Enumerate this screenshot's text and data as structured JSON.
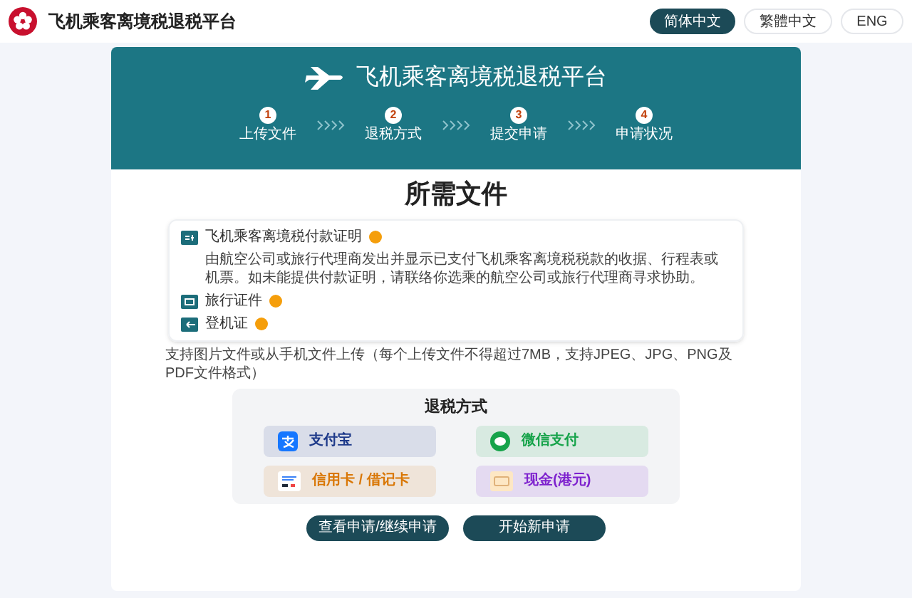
{
  "header": {
    "title": "飞机乘客离境税退税平台",
    "languages": [
      {
        "label": "简体中文",
        "selected": true
      },
      {
        "label": "繁體中文",
        "selected": false
      },
      {
        "label": "ENG",
        "selected": false
      }
    ]
  },
  "banner": {
    "title": "飞机乘客离境税退税平台",
    "steps": [
      {
        "number": "1",
        "label": "上传文件"
      },
      {
        "number": "2",
        "label": "退税方式"
      },
      {
        "number": "3",
        "label": "提交申请"
      },
      {
        "number": "4",
        "label": "申请状况"
      }
    ]
  },
  "documents": {
    "title": "所需文件",
    "items": [
      {
        "kind": "receipt",
        "label": "飞机乘客离境税付款证明",
        "description": "由航空公司或旅行代理商发出并显示已支付飞机乘客离境税税款的收据、行程表或机票。如未能提供付款证明，请联络你选乘的航空公司或旅行代理商寻求协助。"
      },
      {
        "kind": "passport",
        "label": "旅行证件"
      },
      {
        "kind": "boarding",
        "label": "登机证"
      }
    ],
    "note": "支持图片文件或从手机文件上传（每个上传文件不得超过7MB，支持JPEG、JPG、PNG及PDF文件格式）"
  },
  "refund_methods": {
    "title": "退税方式",
    "options": [
      {
        "kind": "alipay",
        "label": "支付宝",
        "color": "#1e3a8a"
      },
      {
        "kind": "wechat",
        "label": "微信支付",
        "color": "#16a34a"
      },
      {
        "kind": "card",
        "label": "信用卡 / 借记卡",
        "color": "#d97706"
      },
      {
        "kind": "cash",
        "label": "现金(港元)",
        "color": "#7e22ce"
      }
    ]
  },
  "buttons": [
    "查看申请/继续申请",
    "开始新申请"
  ]
}
